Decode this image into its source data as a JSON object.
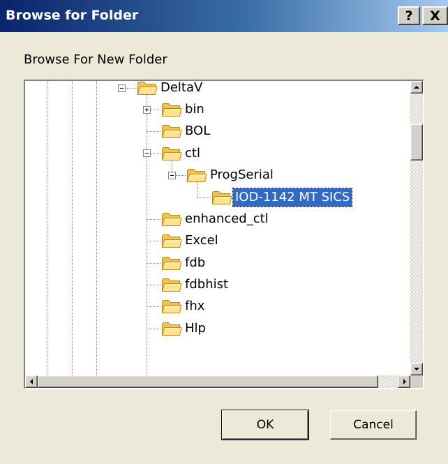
{
  "window": {
    "title": "Browse for Folder",
    "help_label": "?",
    "close_label": "X"
  },
  "prompt": "Browse For New Folder",
  "tree": {
    "nodes": [
      {
        "label": "DeltaV",
        "expander": "minus",
        "state": "expanded"
      },
      {
        "label": "bin",
        "expander": "plus",
        "state": "collapsed"
      },
      {
        "label": "BOL"
      },
      {
        "label": "ctl",
        "expander": "minus",
        "state": "expanded"
      },
      {
        "label": "ProgSerial",
        "expander": "minus",
        "state": "expanded"
      },
      {
        "label": "IOD-1142 MT SICS",
        "selected": true
      },
      {
        "label": "enhanced_ctl"
      },
      {
        "label": "Excel"
      },
      {
        "label": "fdb"
      },
      {
        "label": "fdbhist"
      },
      {
        "label": "fhx"
      },
      {
        "label": "Hlp"
      }
    ]
  },
  "buttons": {
    "ok": "OK",
    "cancel": "Cancel"
  },
  "colors": {
    "title_gradient_start": "#0a246a",
    "title_gradient_end": "#a6caf0",
    "selection": "#316ac5",
    "dialog_face": "#ece9d8",
    "folder_yellow": "#ffd35c"
  },
  "icons": {
    "folder": "folder-icon",
    "expand": "plus-expander-icon",
    "collapse": "minus-expander-icon"
  }
}
